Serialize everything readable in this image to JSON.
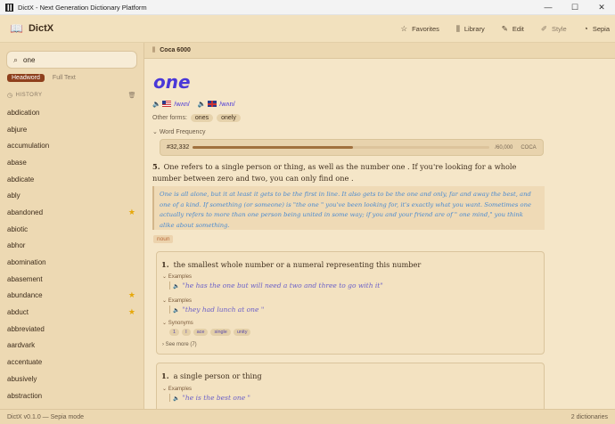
{
  "window": {
    "title": "DictX - Next Generation Dictionary Platform",
    "minimize": "—",
    "maximize": "☐",
    "close": "✕"
  },
  "header": {
    "logo": "DictX",
    "nav": [
      {
        "icon": "☆",
        "label": "Favorites"
      },
      {
        "icon": "⫼",
        "label": "Library"
      },
      {
        "icon": "✎",
        "label": "Edit"
      },
      {
        "icon": "✐",
        "label": "Style"
      },
      {
        "icon": "◔",
        "label": "Sepia"
      }
    ]
  },
  "search": {
    "value": "one",
    "placeholder": "Search"
  },
  "modes": [
    "Headword",
    "Full Text"
  ],
  "history": {
    "title": "HISTORY",
    "items": [
      {
        "word": "abdication",
        "fav": false
      },
      {
        "word": "abjure",
        "fav": false
      },
      {
        "word": "accumulation",
        "fav": false
      },
      {
        "word": "abase",
        "fav": false
      },
      {
        "word": "abdicate",
        "fav": false
      },
      {
        "word": "ably",
        "fav": false
      },
      {
        "word": "abandoned",
        "fav": true
      },
      {
        "word": "abiotic",
        "fav": false
      },
      {
        "word": "abhor",
        "fav": false
      },
      {
        "word": "abomination",
        "fav": false
      },
      {
        "word": "abasement",
        "fav": false
      },
      {
        "word": "abundance",
        "fav": true
      },
      {
        "word": "abduct",
        "fav": true
      },
      {
        "word": "abbreviated",
        "fav": false
      },
      {
        "word": "aardvark",
        "fav": false
      },
      {
        "word": "accentuate",
        "fav": false
      },
      {
        "word": "abusively",
        "fav": false
      },
      {
        "word": "abstraction",
        "fav": false
      }
    ]
  },
  "entry": {
    "source": "Coca 6000",
    "headword": "one",
    "us_ipa": "/wʌn/",
    "uk_ipa": "/wʌn/",
    "forms_label": "Other forms:",
    "forms": [
      "ones",
      "onely"
    ],
    "freq_label": "Word Frequency",
    "rank": "#32,332",
    "rank_fraction": 0.54,
    "total": "/60,000",
    "corpus": "COCA",
    "def_num": "5.",
    "definition": "One refers to a single person or thing, as well as the number one . If you're looking for a whole number between zero and two, you can only find one .",
    "note": "One is all alone, but it at least it gets to be the first in line. It also gets to be the one and only, far and away the best, and one of a kind. If something (or someone) is \"the one \" you've been looking for, it's exactly what you want. Sometimes one actually refers to more than one person being united in some way; if you and your friend are of \" one mind,\" you think alike about something.",
    "pos": "noun",
    "senses": [
      {
        "num": "1.",
        "gloss": "the smallest whole number or a numeral representing this number",
        "examples_label": "Examples",
        "examples": [
          "\"he has the one but will need a two and three to go with it\"",
          "\"they had lunch at one \""
        ],
        "synonyms_label": "Synonyms",
        "synonyms": [
          "1",
          "I",
          "ace",
          "single",
          "unity"
        ],
        "more": "See more (7)"
      },
      {
        "num": "1.",
        "gloss": "a single person or thing",
        "examples_label": "Examples",
        "examples": [
          "\"he is the best one \""
        ]
      }
    ]
  },
  "status": {
    "left": "DictX v0.1.0 — Sepia mode",
    "right": "2 dictionaries"
  }
}
